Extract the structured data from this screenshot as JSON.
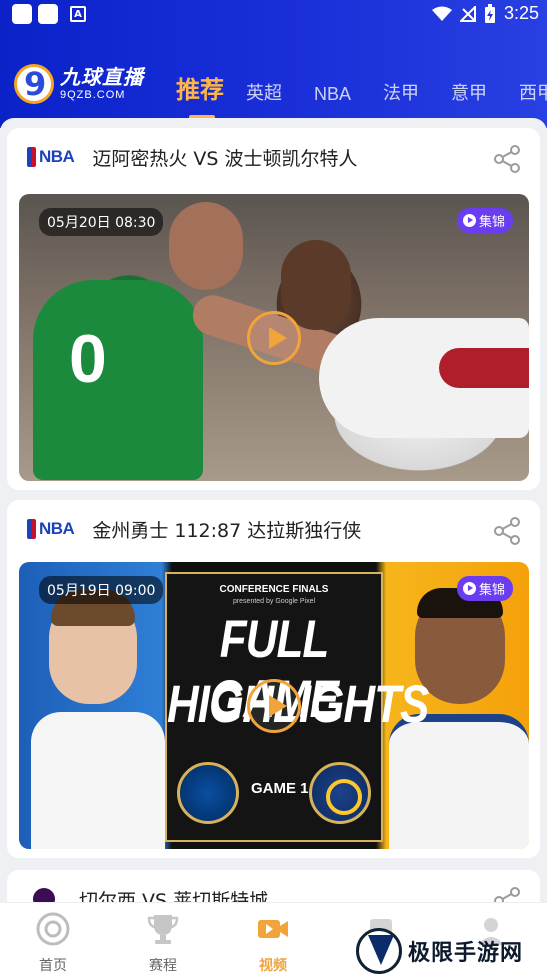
{
  "status_bar": {
    "a_label": "A",
    "time": "3:25"
  },
  "header": {
    "logo_cn": "九球直播",
    "logo_en": "9QZB.COM",
    "tabs": [
      {
        "label": "推荐",
        "active": true
      },
      {
        "label": "英超",
        "active": false
      },
      {
        "label": "NBA",
        "active": false
      },
      {
        "label": "法甲",
        "active": false
      },
      {
        "label": "意甲",
        "active": false
      },
      {
        "label": "西甲",
        "active": false
      }
    ]
  },
  "cards": [
    {
      "league_logo": "NBA",
      "title": "迈阿密热火 VS 波士顿凯尔特人",
      "date": "05月20日 08:30",
      "tag": "集锦",
      "jersey_number": "0"
    },
    {
      "league_logo": "NBA",
      "title": "金州勇士 112:87 达拉斯独行侠",
      "date": "05月19日 09:00",
      "tag": "集锦",
      "poster": {
        "conference": "CONFERENCE FINALS",
        "presented": "presented by Google Pixel",
        "line1": "FULL GAME",
        "line2": "HIGHLIGHTS",
        "game": "GAME 1"
      }
    },
    {
      "league_logo": "premier-league-icon",
      "title": "切尔西 VS 莱切斯特城"
    }
  ],
  "bottom_nav": [
    {
      "label": "首页",
      "icon": "home-target-icon",
      "active": false
    },
    {
      "label": "赛程",
      "icon": "trophy-icon",
      "active": false
    },
    {
      "label": "视频",
      "icon": "video-camera-icon",
      "active": true
    }
  ],
  "watermark": {
    "text": "极限手游网"
  },
  "colors": {
    "header_blue": "#1a2fd8",
    "accent_orange": "#f0a43a",
    "tag_purple": "#6a3df0",
    "nba_blue": "#1d42ba"
  }
}
